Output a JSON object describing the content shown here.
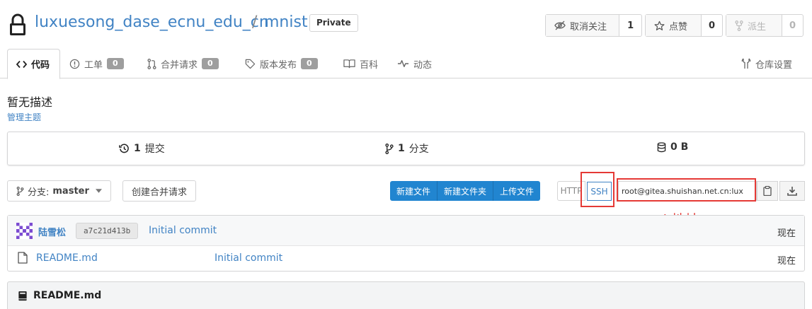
{
  "repo": {
    "owner": "luxuesong_dase_ecnu_edu_cn",
    "separator": "/",
    "name": "mnist",
    "visibility": "Private"
  },
  "header_actions": {
    "watch": {
      "label": "取消关注",
      "count": "1",
      "icon": "eye-slash-icon"
    },
    "star": {
      "label": "点赞",
      "count": "0",
      "icon": "star-icon"
    },
    "fork": {
      "label": "派生",
      "count": "0",
      "icon": "fork-icon"
    }
  },
  "tabs": [
    {
      "label": "代码",
      "icon": "code-icon"
    },
    {
      "label": "工单",
      "badge": "0",
      "icon": "issue-icon"
    },
    {
      "label": "合并请求",
      "badge": "0",
      "icon": "pull-request-icon"
    },
    {
      "label": "版本发布",
      "badge": "0",
      "icon": "tag-icon"
    },
    {
      "label": "百科",
      "icon": "book-icon"
    },
    {
      "label": "动态",
      "icon": "pulse-icon"
    }
  ],
  "settings_tab": {
    "label": "仓库设置",
    "icon": "tools-icon"
  },
  "description": "暂无描述",
  "manage_topics": "管理主题",
  "stats": {
    "commits": {
      "count": "1",
      "label": "提交"
    },
    "branches": {
      "count": "1",
      "label": "分支"
    },
    "size": {
      "value": "0 B"
    }
  },
  "actions": {
    "branch_label": "分支:",
    "branch_name": "master",
    "create_pr": "创建合并请求",
    "new_file": "新建文件",
    "new_folder": "新建文件夹",
    "upload_file": "上传文件"
  },
  "clone": {
    "http_label": "HTTP",
    "ssh_label": "SSH",
    "url": "root@gitea.shuishan.net.cn:lux"
  },
  "annotation": {
    "text": "ssh地址",
    "color": "#e53935"
  },
  "latest_commit": {
    "author": "陆雪松",
    "sha": "a7c21d413b",
    "message": "Initial commit",
    "time": "现在"
  },
  "files": [
    {
      "name": "README.md",
      "message": "Initial commit",
      "time": "现在",
      "icon": "file-icon"
    }
  ],
  "readme": {
    "title": "README.md"
  },
  "colors": {
    "link": "#4183c4",
    "primary": "#2185d0",
    "badge": "#9e9e9e",
    "annotation": "#e53935"
  }
}
